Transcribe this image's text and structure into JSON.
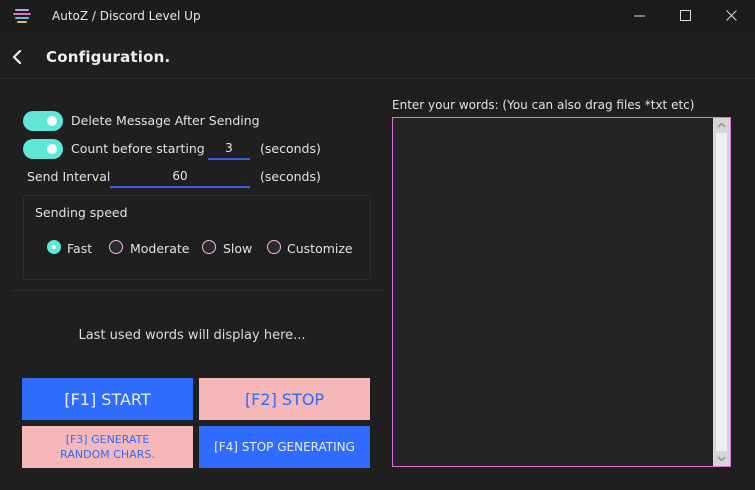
{
  "window": {
    "title": "AutoZ / Discord Level Up"
  },
  "header": {
    "title": "Configuration."
  },
  "options": {
    "delete_message": {
      "label": "Delete Message After Sending",
      "on": true
    },
    "count_before": {
      "label": "Count before starting",
      "value": "3",
      "unit": "(seconds)",
      "on": true
    },
    "send_interval": {
      "label": "Send Interval",
      "value": "60",
      "unit": "(seconds)"
    }
  },
  "speed": {
    "title": "Sending speed",
    "options": [
      "Fast",
      "Moderate",
      "Slow",
      "Customize"
    ],
    "selected": "Fast"
  },
  "last_used": "Last used words will display here...",
  "buttons": {
    "start": "[F1] START",
    "stop": "[F2] STOP",
    "generate_line1": "[F3] GENERATE",
    "generate_line2": "RANDOM CHARS.",
    "stop_generating": "[F4] STOP GENERATING"
  },
  "words": {
    "label": "Enter your words: (You can also drag files *txt etc)",
    "value": ""
  },
  "colors": {
    "accent": "#5ee6d6",
    "blue_button": "#2f6bff",
    "pink_button": "#f5b7b8",
    "textarea_border": "#e070e0"
  }
}
